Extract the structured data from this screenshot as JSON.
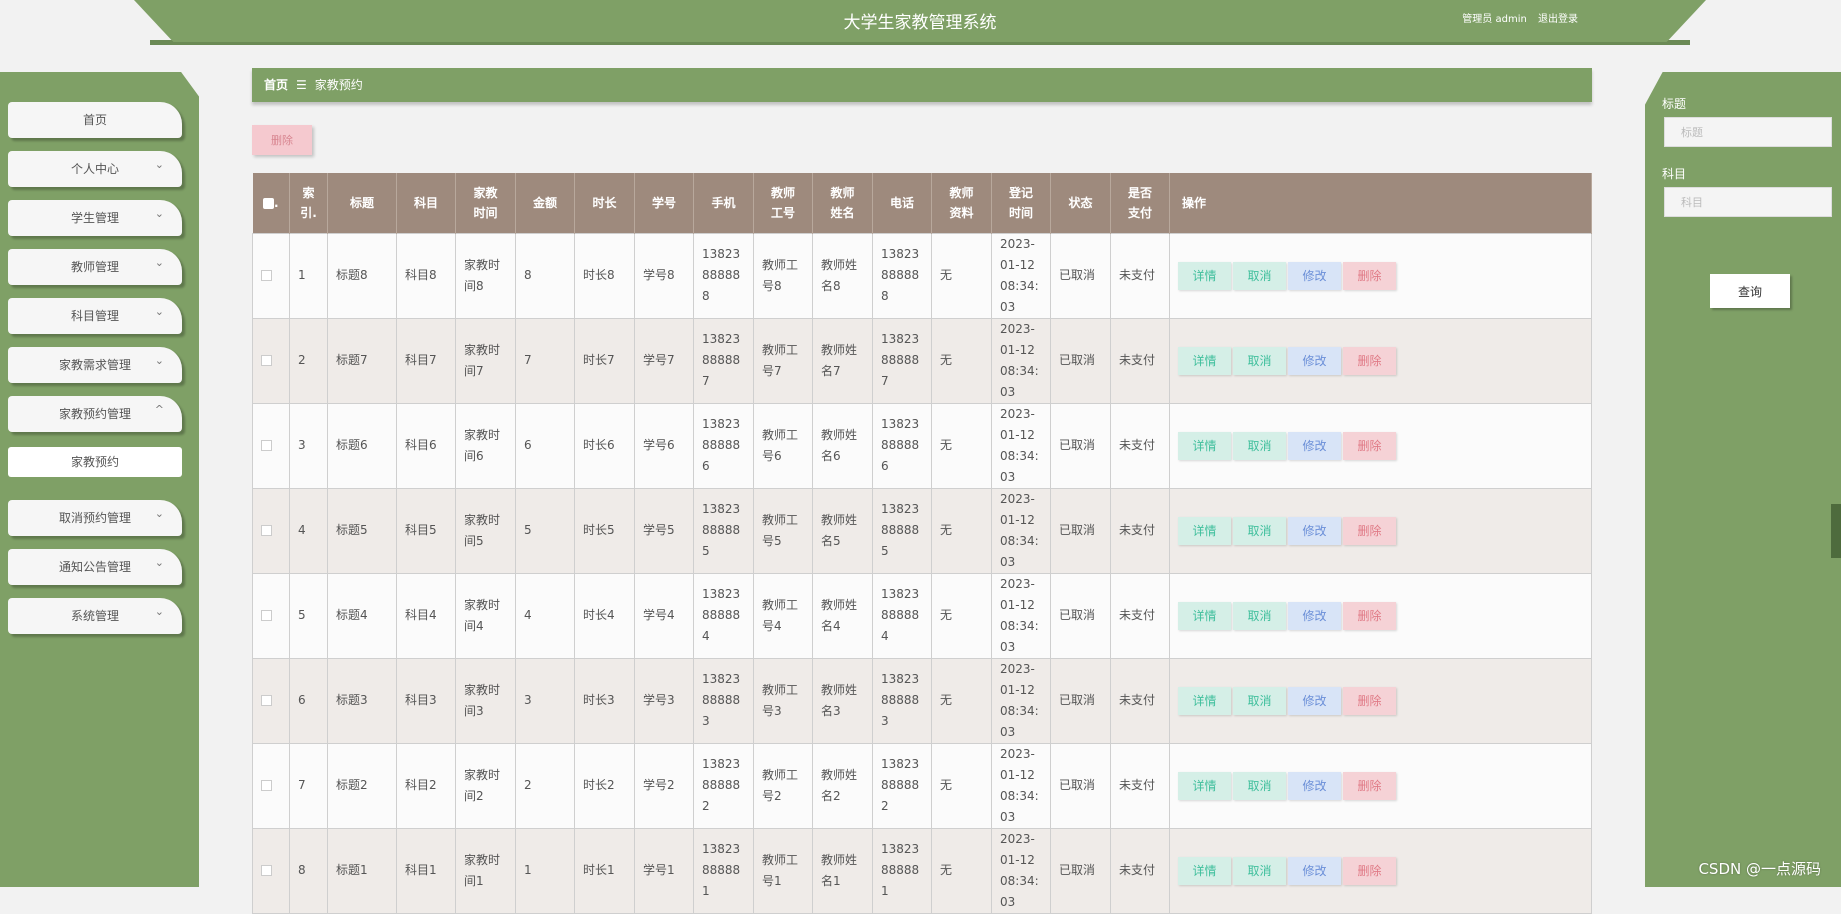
{
  "header": {
    "title": "大学生家教管理系统",
    "user_label": "管理员 admin",
    "logout_label": "退出登录"
  },
  "sidebar": {
    "items": [
      {
        "label": "首页",
        "has_children": false
      },
      {
        "label": "个人中心",
        "has_children": true
      },
      {
        "label": "学生管理",
        "has_children": true
      },
      {
        "label": "教师管理",
        "has_children": true
      },
      {
        "label": "科目管理",
        "has_children": true
      },
      {
        "label": "家教需求管理",
        "has_children": true
      },
      {
        "label": "家教预约管理",
        "has_children": true,
        "expanded": true
      },
      {
        "label": "取消预约管理",
        "has_children": true
      },
      {
        "label": "通知公告管理",
        "has_children": true
      },
      {
        "label": "系统管理",
        "has_children": true
      }
    ],
    "active_sub": {
      "label": "家教预约"
    }
  },
  "breadcrumb": {
    "home": "首页",
    "separator": "☰",
    "current": "家教预约"
  },
  "toolbar": {
    "delete_label": "删除"
  },
  "table": {
    "headers": [
      "索引",
      "标题",
      "科目",
      "家教时间",
      "金额",
      "时长",
      "学号",
      "手机",
      "教师工号",
      "教师姓名",
      "电话",
      "教师资料",
      "登记时间",
      "状态",
      "是否支付",
      "操作"
    ],
    "header_lines": [
      [
        "索",
        "引."
      ],
      [
        "标题"
      ],
      [
        "科目"
      ],
      [
        "家教",
        "时间"
      ],
      [
        "金额"
      ],
      [
        "时长"
      ],
      [
        "学号"
      ],
      [
        "手机"
      ],
      [
        "教师",
        "工号"
      ],
      [
        "教师",
        "姓名"
      ],
      [
        "电话"
      ],
      [
        "教师",
        "资料"
      ],
      [
        "登记",
        "时间"
      ],
      [
        "状态"
      ],
      [
        "是否",
        "支付"
      ],
      [
        "操作"
      ]
    ],
    "rows": [
      {
        "index": "1",
        "title": "标题8",
        "subject": "科目8",
        "time": "家教时间8",
        "amount": "8",
        "duration": "时长8",
        "student_id": "学号8",
        "phone": "13823888888",
        "teacher_id": "教师工号8",
        "teacher_name": "教师姓名8",
        "tel": "13823888888",
        "profile": "无",
        "reg_time": "2023-01-12 08:34:03",
        "status": "已取消",
        "paid": "未支付"
      },
      {
        "index": "2",
        "title": "标题7",
        "subject": "科目7",
        "time": "家教时间7",
        "amount": "7",
        "duration": "时长7",
        "student_id": "学号7",
        "phone": "13823888887",
        "teacher_id": "教师工号7",
        "teacher_name": "教师姓名7",
        "tel": "13823888887",
        "profile": "无",
        "reg_time": "2023-01-12 08:34:03",
        "status": "已取消",
        "paid": "未支付"
      },
      {
        "index": "3",
        "title": "标题6",
        "subject": "科目6",
        "time": "家教时间6",
        "amount": "6",
        "duration": "时长6",
        "student_id": "学号6",
        "phone": "13823888886",
        "teacher_id": "教师工号6",
        "teacher_name": "教师姓名6",
        "tel": "13823888886",
        "profile": "无",
        "reg_time": "2023-01-12 08:34:03",
        "status": "已取消",
        "paid": "未支付"
      },
      {
        "index": "4",
        "title": "标题5",
        "subject": "科目5",
        "time": "家教时间5",
        "amount": "5",
        "duration": "时长5",
        "student_id": "学号5",
        "phone": "13823888885",
        "teacher_id": "教师工号5",
        "teacher_name": "教师姓名5",
        "tel": "13823888885",
        "profile": "无",
        "reg_time": "2023-01-12 08:34:03",
        "status": "已取消",
        "paid": "未支付"
      },
      {
        "index": "5",
        "title": "标题4",
        "subject": "科目4",
        "time": "家教时间4",
        "amount": "4",
        "duration": "时长4",
        "student_id": "学号4",
        "phone": "13823888884",
        "teacher_id": "教师工号4",
        "teacher_name": "教师姓名4",
        "tel": "13823888884",
        "profile": "无",
        "reg_time": "2023-01-12 08:34:03",
        "status": "已取消",
        "paid": "未支付"
      },
      {
        "index": "6",
        "title": "标题3",
        "subject": "科目3",
        "time": "家教时间3",
        "amount": "3",
        "duration": "时长3",
        "student_id": "学号3",
        "phone": "13823888883",
        "teacher_id": "教师工号3",
        "teacher_name": "教师姓名3",
        "tel": "13823888883",
        "profile": "无",
        "reg_time": "2023-01-12 08:34:03",
        "status": "已取消",
        "paid": "未支付"
      },
      {
        "index": "7",
        "title": "标题2",
        "subject": "科目2",
        "time": "家教时间2",
        "amount": "2",
        "duration": "时长2",
        "student_id": "学号2",
        "phone": "13823888882",
        "teacher_id": "教师工号2",
        "teacher_name": "教师姓名2",
        "tel": "13823888882",
        "profile": "无",
        "reg_time": "2023-01-12 08:34:03",
        "status": "已取消",
        "paid": "未支付"
      },
      {
        "index": "8",
        "title": "标题1",
        "subject": "科目1",
        "time": "家教时间1",
        "amount": "1",
        "duration": "时长1",
        "student_id": "学号1",
        "phone": "13823888881",
        "teacher_id": "教师工号1",
        "teacher_name": "教师姓名1",
        "tel": "13823888881",
        "profile": "无",
        "reg_time": "2023-01-12 08:34:03",
        "status": "已取消",
        "paid": "未支付"
      }
    ],
    "actions": {
      "detail": "详情",
      "cancel": "取消",
      "edit": "修改",
      "delete": "删除"
    }
  },
  "search": {
    "title_label": "标题",
    "title_placeholder": "标题",
    "subject_label": "科目",
    "subject_placeholder": "科目",
    "query_label": "查询"
  },
  "watermark": "CSDN @一点源码",
  "colors": {
    "brand_green": "#7fa066",
    "table_header": "#9e8a7d",
    "detail_btn": "#3fbf9c",
    "edit_btn": "#6b8fd8",
    "delete_btn": "#e07a86"
  }
}
